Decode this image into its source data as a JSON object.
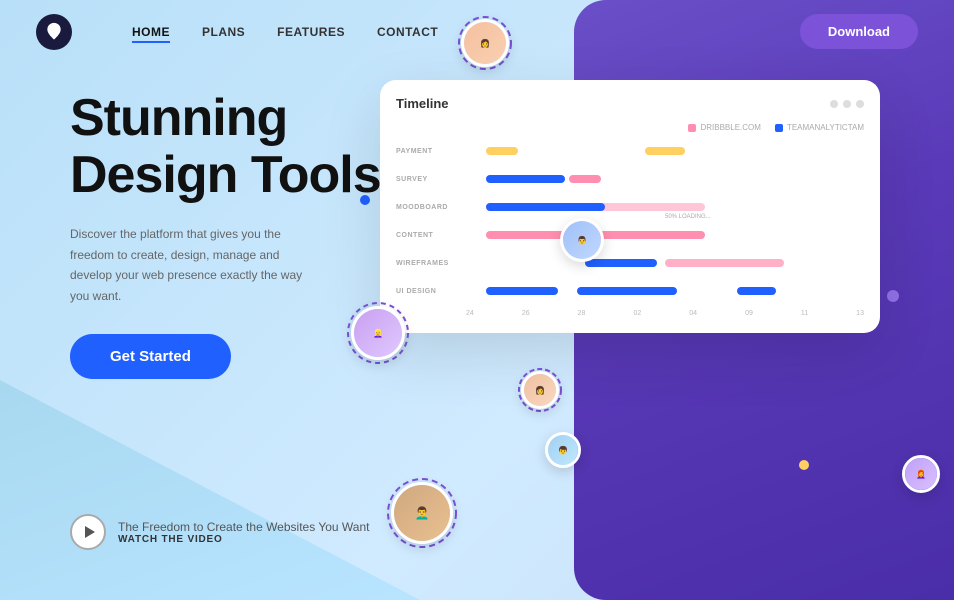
{
  "meta": {
    "title": "Stunning Design Tools"
  },
  "colors": {
    "primary": "#2060ff",
    "purple": "#7b52d8",
    "dark": "#1a1a3e",
    "accent_pink": "#ff8eb0",
    "accent_yellow": "#ffd060",
    "bg_blue": "#c8e8f8"
  },
  "navbar": {
    "logo_alt": "Brand Logo",
    "links": [
      {
        "label": "HOME",
        "active": true
      },
      {
        "label": "PLANS",
        "active": false
      },
      {
        "label": "FEATURES",
        "active": false
      },
      {
        "label": "CONTACT",
        "active": false
      }
    ],
    "download_label": "Download"
  },
  "hero": {
    "title_line1": "Stunning",
    "title_line2": "Design Tools",
    "description": "Discover the platform that gives you the freedom to create, design, manage and develop your web presence exactly the way you want.",
    "cta_label": "Get Started"
  },
  "video_cta": {
    "main_text": "The Freedom to Create the Websites You Want",
    "watch_label": "WATCH THE VIDEO"
  },
  "timeline_card": {
    "title": "Timeline",
    "legend": [
      {
        "label": "DRIBBBLE.COM",
        "color": "#ff8eb0"
      },
      {
        "label": "TEAMANALYTICTAM",
        "color": "#2060ff"
      }
    ],
    "rows": [
      {
        "label": "PAYMENT",
        "bars": [
          {
            "color": "#ffd060",
            "left": "5%",
            "width": "8%"
          },
          {
            "color": "#ffd060",
            "left": "45%",
            "width": "10%"
          }
        ]
      },
      {
        "label": "SURVEY",
        "bars": [
          {
            "color": "#2060ff",
            "left": "5%",
            "width": "20%"
          },
          {
            "color": "#ff8eb0",
            "left": "26%",
            "width": "8%"
          }
        ]
      },
      {
        "label": "MOODBOARD",
        "bars": [
          {
            "color": "#2060ff",
            "left": "5%",
            "width": "30%"
          },
          {
            "color": "#ff8eb0",
            "left": "5%",
            "width": "50%"
          }
        ]
      },
      {
        "label": "CONTENT",
        "bars": [
          {
            "color": "#ff8eb0",
            "left": "5%",
            "width": "55%"
          }
        ]
      },
      {
        "label": "WIREFRAMES",
        "bars": [
          {
            "color": "#2060ff",
            "left": "30%",
            "width": "18%"
          },
          {
            "color": "#ff8eb0",
            "left": "50%",
            "width": "30%"
          }
        ]
      },
      {
        "label": "UI DESIGN",
        "bars": [
          {
            "color": "#2060ff",
            "left": "5%",
            "width": "18%"
          },
          {
            "color": "#2060ff",
            "left": "28%",
            "width": "25%"
          },
          {
            "color": "#2060ff",
            "left": "68%",
            "width": "10%"
          }
        ]
      }
    ],
    "axis_labels": [
      "24",
      "26",
      "28",
      "02",
      "04",
      "09",
      "11",
      "13"
    ]
  }
}
